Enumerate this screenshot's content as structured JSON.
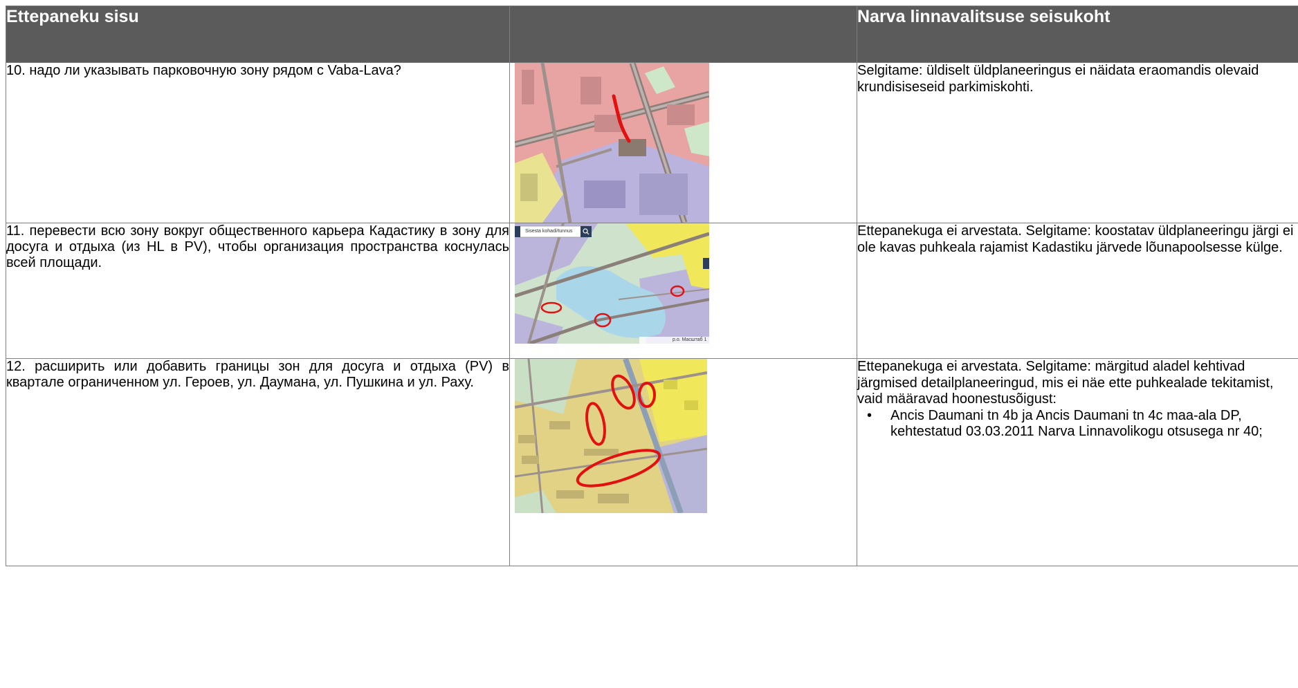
{
  "table": {
    "headers": {
      "col1": "Ettepaneku sisu",
      "col2": "",
      "col3": "Narva linnavalitsuse seisukoht"
    },
    "rows": [
      {
        "proposal": "10. надо ли указывать парковочную зону рядом с Vaba-Lava?",
        "response": "Selgitame: üldiselt üldplaneeringus ei näidata eraomandis olevaid krundisiseseid parkimiskohti."
      },
      {
        "proposal": "11. перевести всю зону вокруг общественного карьера Кадастику в зону для досуга и отдыха (из HL в PV), чтобы организация пространства коснулась всей площади.",
        "response": "Ettepanekuga ei arvestata. Selgitame: koostatav üldplaneeringu järgi ei ole kavas puhkeala rajamist Kadastiku järvede lõunapoolsesse külge.",
        "map_search_placeholder": "Sisesta kohadi/tunnus",
        "map_scale_text": "p.o. Масштаб 1"
      },
      {
        "proposal": "12. расширить или добавить границы зон для досуга и отдыха (PV) в квартале ограниченном ул. Героев, ул. Даумана, ул. Пушкина и ул. Раху.",
        "response": "Ettepanekuga ei arvestata. Selgitame: märgitud aladel kehtivad järgmised detailplaneeringud, mis ei näe ette puhkealade tekitamist, vaid määravad hoonestusõigust:",
        "bullets": [
          "Ancis Daumani tn 4b ja Ancis Daumani tn 4c maa-ala DP, kehtestatud 03.03.2011 Narva Linnavolikogu otsusega nr 40;"
        ]
      }
    ]
  },
  "colors": {
    "header_bg": "#5b5b5b",
    "header_text": "#ffffff",
    "border": "#7f7f7f",
    "map_markup_red": "#e31010"
  }
}
